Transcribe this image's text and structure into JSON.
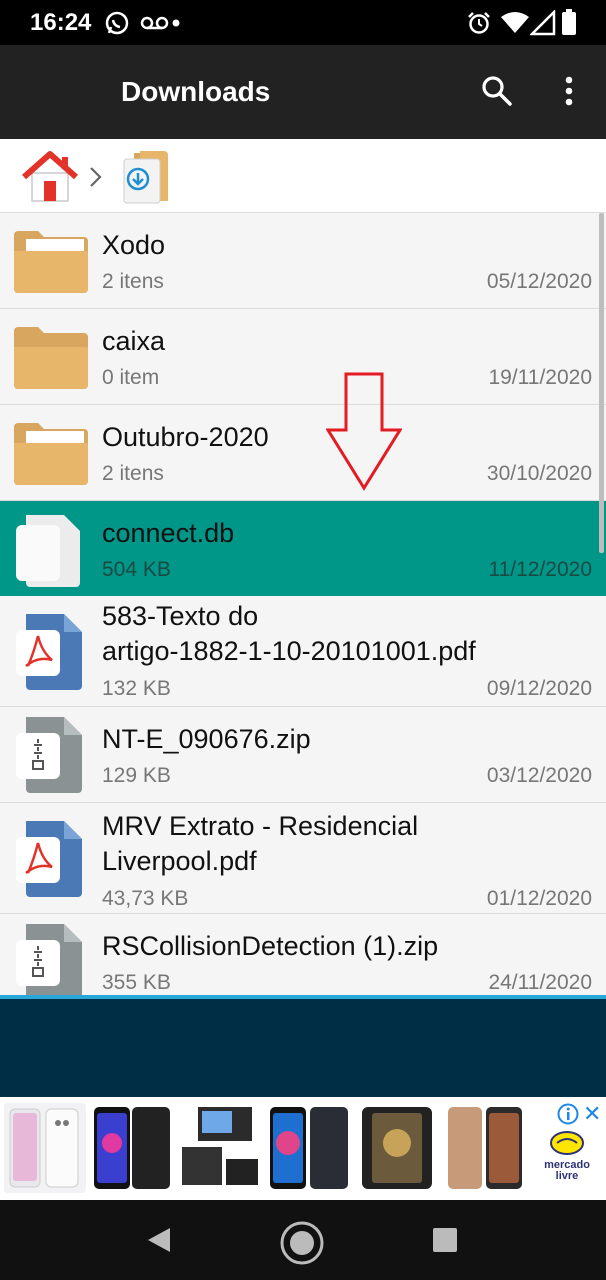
{
  "status_bar": {
    "time": "16:24",
    "icons": [
      "whatsapp-icon",
      "voicemail-icon",
      "alarm-icon",
      "wifi-icon",
      "signal-icon",
      "battery-icon"
    ]
  },
  "app_bar": {
    "title": "Downloads",
    "actions": [
      "search-icon",
      "more-vert-icon"
    ]
  },
  "breadcrumb": {
    "items": [
      "home-icon",
      "downloads-folder-icon"
    ]
  },
  "files": [
    {
      "name": "Xodo",
      "meta": "2 itens",
      "date": "05/12/2020",
      "type": "folder"
    },
    {
      "name": "caixa",
      "meta": "0 item",
      "date": "19/11/2020",
      "type": "folder"
    },
    {
      "name": "Outubro-2020",
      "meta": "2 itens",
      "date": "30/10/2020",
      "type": "folder"
    },
    {
      "name": "connect.db",
      "meta": "504 KB",
      "date": "11/12/2020",
      "type": "file",
      "selected": true
    },
    {
      "name_line1": "583-Texto do",
      "name_line2": "artigo-1882-1-10-20101001.pdf",
      "meta": "132 KB",
      "date": "09/12/2020",
      "type": "pdf"
    },
    {
      "name": "NT-E_090676.zip",
      "meta": "129 KB",
      "date": "03/12/2020",
      "type": "zip"
    },
    {
      "name_line1": "MRV Extrato - Residencial",
      "name_line2": "Liverpool.pdf",
      "meta": "43,73 KB",
      "date": "01/12/2020",
      "type": "pdf"
    },
    {
      "name": "RSCollisionDetection (1).zip",
      "meta": "355 KB",
      "date": "24/11/2020",
      "type": "zip"
    }
  ],
  "ad": {
    "brand_line1": "mercado",
    "brand_line2": "livre",
    "thumbs": [
      "phone-white",
      "phone-blue",
      "oscilloscope",
      "phone-galaxy",
      "phone-rugged",
      "phone-note"
    ]
  },
  "colors": {
    "app_bar": "#222222",
    "selected_row": "#009688",
    "folder": "#E8B66A",
    "pdf": "#4A79B5",
    "zip": "#8A9294",
    "dark_zone": "#002F45"
  }
}
